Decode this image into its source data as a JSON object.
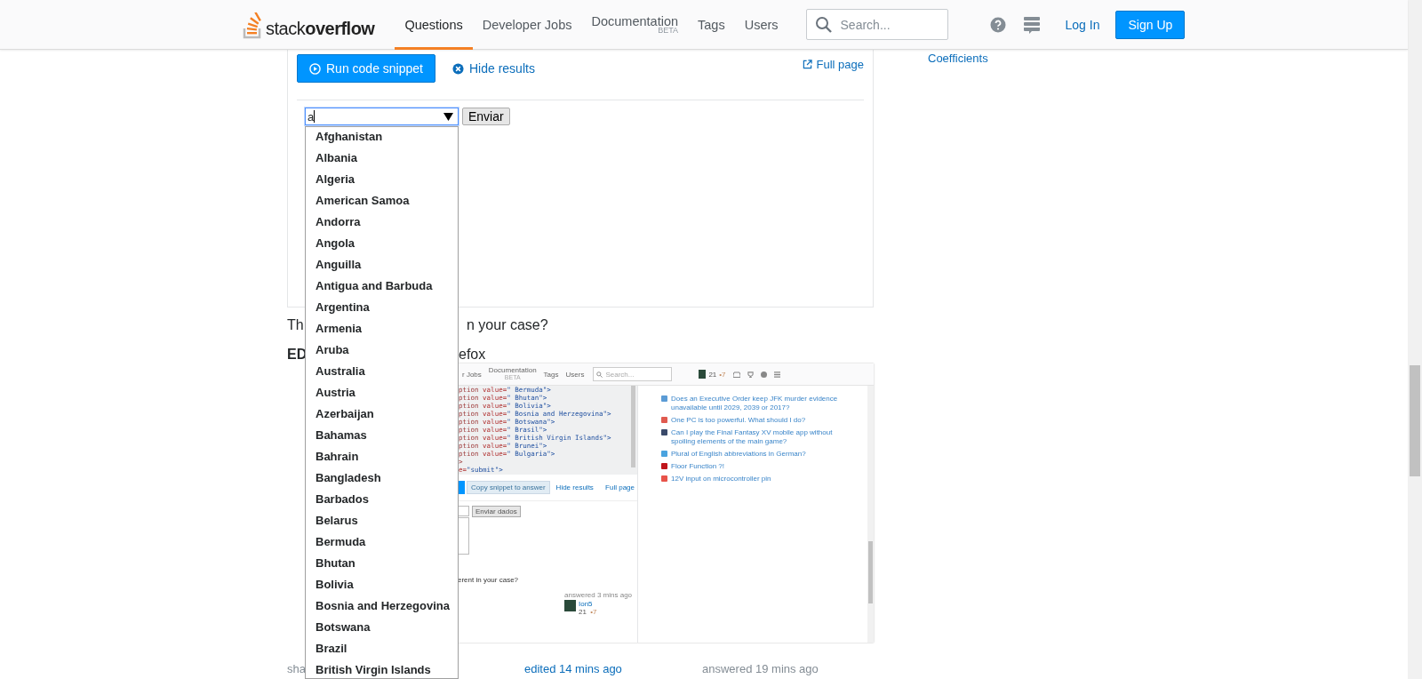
{
  "header": {
    "logo": {
      "light": "stack",
      "bold": "overflow"
    },
    "nav": [
      {
        "label": "Questions",
        "selected": true
      },
      {
        "label": "Developer Jobs",
        "selected": false
      },
      {
        "label": "Documentation",
        "badge": "BETA",
        "selected": false
      },
      {
        "label": "Tags",
        "selected": false
      },
      {
        "label": "Users",
        "selected": false
      }
    ],
    "search": {
      "placeholder": "Search..."
    },
    "login": "Log In",
    "signup": "Sign Up"
  },
  "sidebar_cut_text": "Coefficients",
  "snippet": {
    "run_button": "Run code snippet",
    "hide_results": "Hide results",
    "full_page": "Full page",
    "combo": {
      "value": "a",
      "focused": true
    },
    "submit": "Enviar",
    "options": [
      "Afghanistan",
      "Albania",
      "Algeria",
      "American Samoa",
      "Andorra",
      "Angola",
      "Anguilla",
      "Antigua and Barbuda",
      "Argentina",
      "Armenia",
      "Aruba",
      "Australia",
      "Austria",
      "Azerbaijan",
      "Bahamas",
      "Bahrain",
      "Bangladesh",
      "Barbados",
      "Belarus",
      "Bermuda",
      "Bhutan",
      "Bolivia",
      "Bosnia and Herzegovina",
      "Botswana",
      "Brazil",
      "British Virgin Islands"
    ]
  },
  "answer_text": {
    "question_start": "Th",
    "question_end": "n your case?",
    "edit_start": "ED",
    "edit_end": "efox"
  },
  "embedded_screenshot": {
    "nav": [
      "r Jobs",
      "Documentation",
      "Tags",
      "Users"
    ],
    "nav_badge": "BETA",
    "search_placeholder": "Search...",
    "reputation": "21",
    "bronze": "•7",
    "code_lines": [
      {
        "tag": "ption ",
        "attr": "value=",
        "str": "\" Bermuda\">"
      },
      {
        "tag": "ption ",
        "attr": "value=",
        "str": "\" Bhutan\">"
      },
      {
        "tag": "ption ",
        "attr": "value=",
        "str": "\" Bolivia\">"
      },
      {
        "tag": "ption ",
        "attr": "value=",
        "str": "\" Bosnia and Herzegovina\">"
      },
      {
        "tag": "ption ",
        "attr": "value=",
        "str": "\" Botswana\">"
      },
      {
        "tag": "ption ",
        "attr": "value=",
        "str": "\" Brasil\">"
      },
      {
        "tag": "ption ",
        "attr": "value=",
        "str": "\" British Virgin Islands\">"
      },
      {
        "tag": "ption ",
        "attr": "value=",
        "str": "\" Brunei\">"
      },
      {
        "tag": "ption ",
        "attr": "value=",
        "str": "\" Bulgaria\">"
      },
      {
        "tag": ">"
      },
      {
        "attr": "e=",
        "str": "\"submit\">"
      }
    ],
    "copy_button": "Copy snippet to answer",
    "hide_results": "Hide results",
    "full_page": "Full page",
    "submit": "Enviar dados",
    "question_text": "erent in your case?",
    "answered": "answered 3 mins ago",
    "user": "Ion5",
    "user_rep": "21",
    "user_bronze": "•7",
    "hot_links": [
      {
        "text": "Does an Executive Order keep JFK murder evidence unavailable until 2029, 2039 or 2017?",
        "color": "#5b9bd5"
      },
      {
        "text": "One PC is too powerful. What should I do?",
        "color": "#e05a4f"
      },
      {
        "text": "Can I play the Final Fantasy XV mobile app without spoiling elements of the main game?",
        "color": "#3a4a6a"
      },
      {
        "text": "Plural of English abbreviations in German?",
        "color": "#4aa3df"
      },
      {
        "text": "Floor Function ?!",
        "color": "#c0151b"
      },
      {
        "text": "12V input on microcontroller pin",
        "color": "#e8534a"
      }
    ]
  },
  "footer": {
    "share_cut": "sha",
    "edited": "edited 14 mins ago",
    "answered": "answered 19 mins ago"
  }
}
